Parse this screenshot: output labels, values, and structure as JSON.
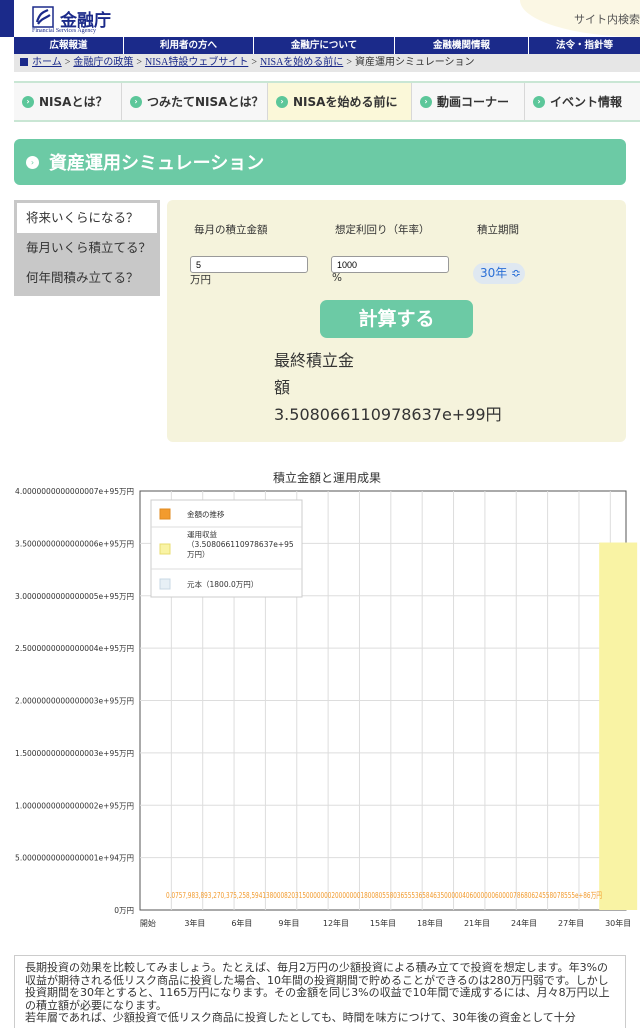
{
  "header": {
    "logo_name": "金融庁",
    "logo_sub": "Financial Services Agency",
    "site_link": "サイト内検索"
  },
  "nav": [
    {
      "label": "広報報道"
    },
    {
      "label": "利用者の方へ"
    },
    {
      "label": "金融庁について"
    },
    {
      "label": "金融機関情報"
    },
    {
      "label": "法令・指針等"
    }
  ],
  "breadcrumb": {
    "items": [
      "ホーム",
      "金融庁の政策",
      "NISA特設ウェブサイト",
      "NISAを始める前に"
    ],
    "separator": ">",
    "current": "資産運用シミュレーション"
  },
  "tabs": [
    {
      "label": "NISAとは？",
      "active": false
    },
    {
      "label": "つみたてNISAとは？",
      "active": false
    },
    {
      "label": "NISAを始める前に",
      "active": true
    },
    {
      "label": "動画コーナー",
      "active": false
    },
    {
      "label": "イベント情報",
      "active": false
    }
  ],
  "page_title": "資産運用シミュレーション",
  "side_menu": [
    {
      "label": "将来いくらになる？",
      "active": true
    },
    {
      "label": "毎月いくら積立てる？",
      "active": false
    },
    {
      "label": "何年間積み立てる？",
      "active": false
    }
  ],
  "form": {
    "monthly_label": "毎月の積立金額",
    "monthly_value": "5",
    "monthly_unit": "万円",
    "rate_label": "想定利回り（年率）",
    "rate_value": "1000",
    "rate_unit": "%",
    "period_label": "積立期間",
    "period_value": "30年 ≎",
    "calc_button": "計算する",
    "result_label": "最終積立金額",
    "result_value": "3.508066110978637e+99円"
  },
  "chart_data": {
    "type": "bar",
    "title": "積立金額と運用成果",
    "categories": [
      "開始",
      "3年目",
      "6年目",
      "9年目",
      "12年目",
      "15年目",
      "18年目",
      "21年目",
      "24年目",
      "27年目",
      "30年目"
    ],
    "y_ticks": [
      "4.0000000000000007e+95万円",
      "3.5000000000000006e+95万円",
      "3.0000000000000005e+95万円",
      "2.5000000000000004e+95万円",
      "2.0000000000000003e+95万円",
      "1.5000000000000003e+95万円",
      "1.0000000000000002e+95万円",
      "5.0000000000000001e+94万円",
      "0万円"
    ],
    "ylim": [
      0,
      4.0000000000000007e+95
    ],
    "series": [
      {
        "name": "元本（1800.0万円）",
        "color": "#e7f0f6",
        "values": [
          0,
          180,
          360,
          540,
          720,
          900,
          1080,
          1260,
          1440,
          1620,
          1800
        ]
      },
      {
        "name": "運用収益（3.508066110978637e+95万円）",
        "color": "#f9f3a4",
        "values": [
          0,
          0,
          0,
          0,
          0,
          0,
          0,
          0,
          0,
          0,
          3.508066110978637e+95
        ]
      }
    ],
    "line_series": {
      "name": "金額の推移",
      "color": "#f29b2e"
    },
    "bottom_label_text": "0.0757,983,893,270,375,258,59413800082031500000002000000018008055803655536584635000004060000006000078680624558078555e+86万円",
    "legend": {
      "position": "top-left"
    },
    "grid": true
  },
  "description": {
    "paragraphs": [
      "長期投資の効果を比較してみましょう。たとえば、毎月2万円の少額投資による積み立てで投資を想定します。年3%の収益が期待される低リスク商品に投資した場合、10年間の投資期間で貯めることができるのは280万円弱です。しかし投資期間を30年とすると、1165万円になります。その金額を同じ3%の収益で10年間で達成するには、月々8万円以上の積立額が必要になります。",
      "若年層であれば、少額投資で低リスク商品に投資したとしても、時間を味方につけて、30年後の資金として十分"
    ]
  }
}
